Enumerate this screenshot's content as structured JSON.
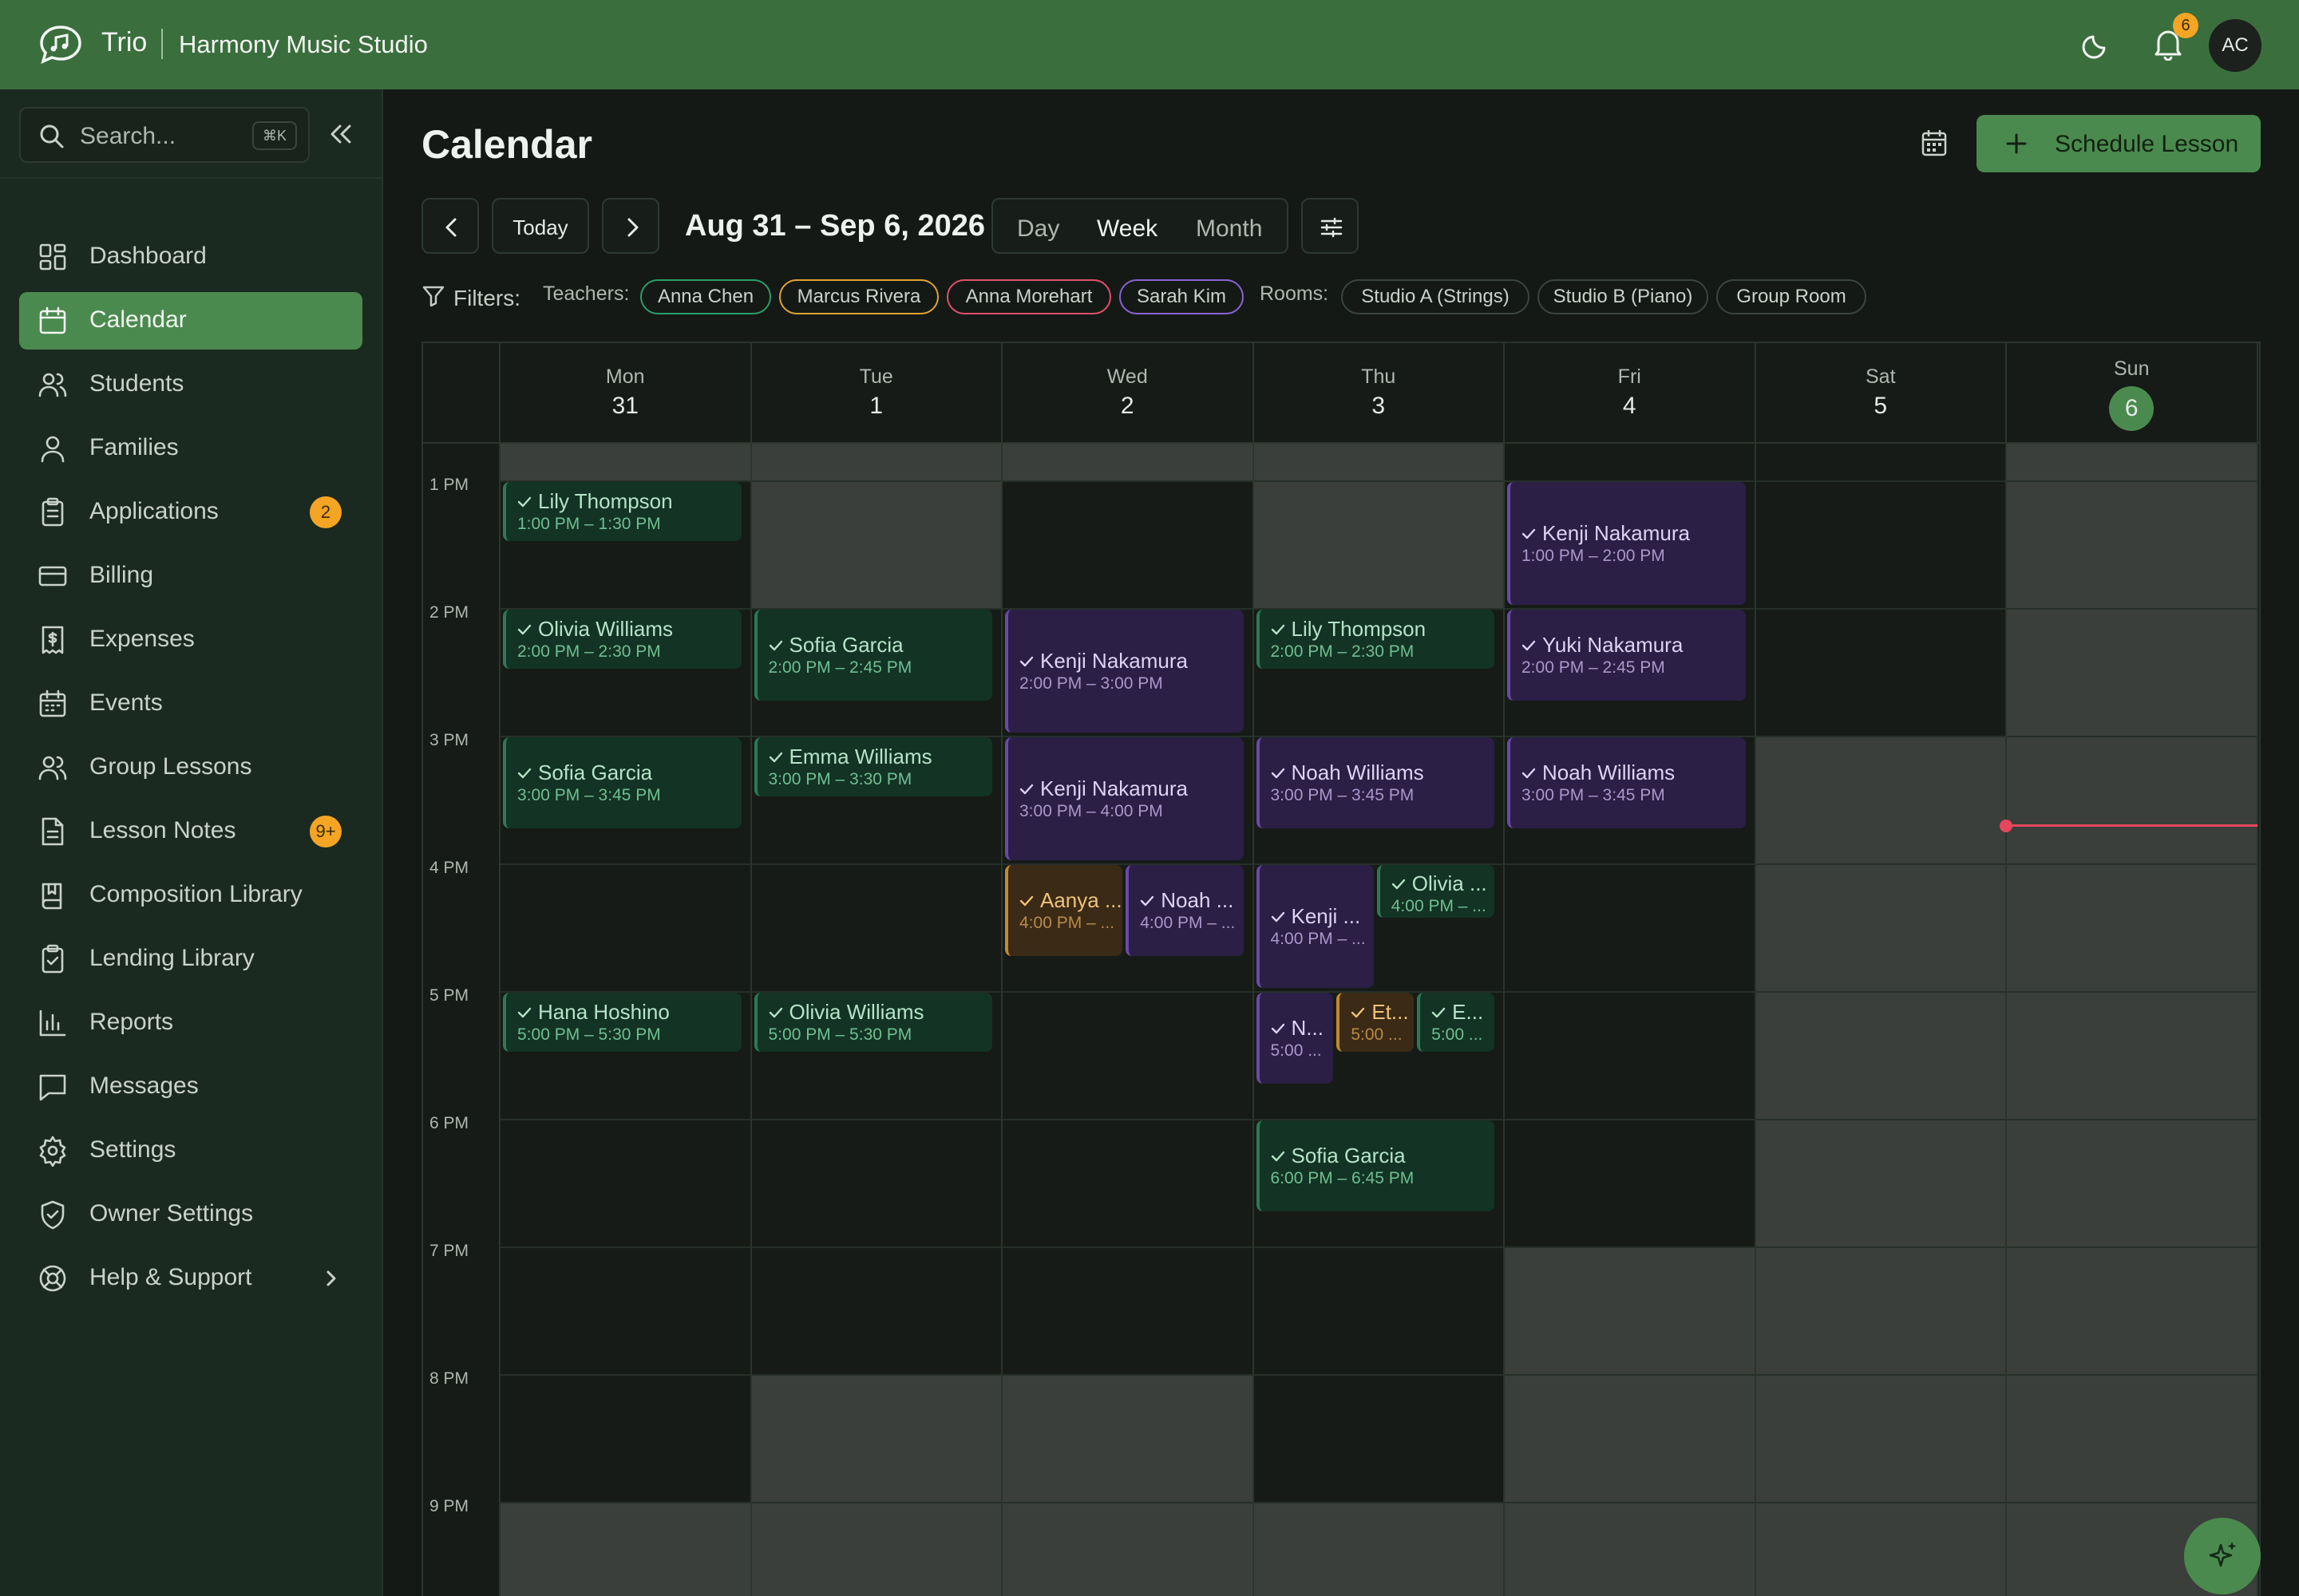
{
  "topbar": {
    "app_name": "Trio",
    "org_name": "Harmony Music Studio",
    "notification_count": "6",
    "avatar_initials": "AC",
    "icons": [
      "logo-chat-music-icon",
      "moon-icon",
      "bell-icon"
    ]
  },
  "sidebar": {
    "search_placeholder": "Search...",
    "search_shortcut": "⌘K",
    "items": [
      {
        "label": "Dashboard",
        "icon": "dashboard-icon"
      },
      {
        "label": "Calendar",
        "icon": "calendar-icon",
        "active": true
      },
      {
        "label": "Students",
        "icon": "users-icon"
      },
      {
        "label": "Families",
        "icon": "user-icon"
      },
      {
        "label": "Applications",
        "icon": "clipboard-icon",
        "badge": "2"
      },
      {
        "label": "Billing",
        "icon": "credit-card-icon"
      },
      {
        "label": "Expenses",
        "icon": "receipt-icon"
      },
      {
        "label": "Events",
        "icon": "calendar-grid-icon"
      },
      {
        "label": "Group Lessons",
        "icon": "group-icon"
      },
      {
        "label": "Lesson Notes",
        "icon": "notes-icon",
        "badge": "9+"
      },
      {
        "label": "Composition Library",
        "icon": "book-icon"
      },
      {
        "label": "Lending Library",
        "icon": "clipboard-check-icon"
      },
      {
        "label": "Reports",
        "icon": "bar-chart-icon"
      },
      {
        "label": "Messages",
        "icon": "message-icon"
      },
      {
        "label": "Settings",
        "icon": "gear-icon"
      },
      {
        "label": "Owner Settings",
        "icon": "shield-icon"
      },
      {
        "label": "Help & Support",
        "icon": "lifebuoy-icon"
      }
    ]
  },
  "main": {
    "title": "Calendar",
    "schedule_button": "Schedule Lesson",
    "today_button": "Today",
    "date_range": "Aug 31 – Sep 6, 2026",
    "views": [
      "Day",
      "Week",
      "Month"
    ],
    "active_view": "Week",
    "filters": {
      "label": "Filters:",
      "teachers_label": "Teachers:",
      "teachers": [
        {
          "name": "Anna Chen",
          "color": "#2b9d6a"
        },
        {
          "name": "Marcus Rivera",
          "color": "#e0a431"
        },
        {
          "name": "Anna Morehart",
          "color": "#e0506b"
        },
        {
          "name": "Sarah Kim",
          "color": "#8a63d2"
        }
      ],
      "rooms_label": "Rooms:",
      "rooms": [
        "Studio A (Strings)",
        "Studio B (Piano)",
        "Group Room"
      ]
    }
  },
  "calendar": {
    "days": [
      {
        "name": "Mon",
        "date": "31"
      },
      {
        "name": "Tue",
        "date": "1"
      },
      {
        "name": "Wed",
        "date": "2"
      },
      {
        "name": "Thu",
        "date": "3"
      },
      {
        "name": "Fri",
        "date": "4"
      },
      {
        "name": "Sat",
        "date": "5"
      },
      {
        "name": "Sun",
        "date": "6",
        "today": true
      }
    ],
    "hours": [
      "1 PM",
      "2 PM",
      "3 PM",
      "4 PM",
      "5 PM",
      "6 PM",
      "7 PM",
      "8 PM",
      "9 PM"
    ],
    "events": [
      {
        "day": 0,
        "start": 13.0,
        "end": 13.5,
        "title": "Lily Thompson",
        "time": "1:00 PM – 1:30 PM",
        "color": "green"
      },
      {
        "day": 0,
        "start": 14.0,
        "end": 14.5,
        "title": "Olivia Williams",
        "time": "2:00 PM – 2:30 PM",
        "color": "green"
      },
      {
        "day": 0,
        "start": 15.0,
        "end": 15.75,
        "title": "Sofia Garcia",
        "time": "3:00 PM – 3:45 PM",
        "color": "green"
      },
      {
        "day": 0,
        "start": 17.0,
        "end": 17.5,
        "title": "Hana Hoshino",
        "time": "5:00 PM – 5:30 PM",
        "color": "green"
      },
      {
        "day": 1,
        "start": 14.0,
        "end": 14.75,
        "title": "Sofia Garcia",
        "time": "2:00 PM – 2:45 PM",
        "color": "green"
      },
      {
        "day": 1,
        "start": 15.0,
        "end": 15.5,
        "title": "Emma Williams",
        "time": "3:00 PM – 3:30 PM",
        "color": "green"
      },
      {
        "day": 1,
        "start": 17.0,
        "end": 17.5,
        "title": "Olivia Williams",
        "time": "5:00 PM – 5:30 PM",
        "color": "green"
      },
      {
        "day": 2,
        "start": 14.0,
        "end": 15.0,
        "title": "Kenji Nakamura",
        "time": "2:00 PM – 3:00 PM",
        "color": "purple"
      },
      {
        "day": 2,
        "start": 15.0,
        "end": 16.0,
        "title": "Kenji Nakamura",
        "time": "3:00 PM – 4:00 PM",
        "color": "purple"
      },
      {
        "day": 2,
        "start": 16.0,
        "end": 16.75,
        "title": "Aanya ...",
        "time": "4:00 PM – ...",
        "color": "amber",
        "col": 0,
        "cols": 2
      },
      {
        "day": 2,
        "start": 16.0,
        "end": 16.75,
        "title": "Noah ...",
        "time": "4:00 PM – ...",
        "color": "purple",
        "col": 1,
        "cols": 2
      },
      {
        "day": 3,
        "start": 14.0,
        "end": 14.5,
        "title": "Lily Thompson",
        "time": "2:00 PM – 2:30 PM",
        "color": "green"
      },
      {
        "day": 3,
        "start": 15.0,
        "end": 15.75,
        "title": "Noah Williams",
        "time": "3:00 PM – 3:45 PM",
        "color": "purple"
      },
      {
        "day": 3,
        "start": 16.0,
        "end": 17.0,
        "title": "Kenji ...",
        "time": "4:00 PM – ...",
        "color": "purple",
        "col": 0,
        "cols": 2
      },
      {
        "day": 3,
        "start": 16.0,
        "end": 16.45,
        "title": "Olivia ...",
        "time": "4:00 PM – ...",
        "color": "green",
        "col": 1,
        "cols": 2
      },
      {
        "day": 3,
        "start": 17.0,
        "end": 17.75,
        "title": "N...",
        "time": "5:00 ...",
        "color": "purple",
        "col": 0,
        "cols": 3
      },
      {
        "day": 3,
        "start": 17.0,
        "end": 17.5,
        "title": "Et...",
        "time": "5:00 ...",
        "color": "amber",
        "col": 1,
        "cols": 3
      },
      {
        "day": 3,
        "start": 17.0,
        "end": 17.5,
        "title": "E...",
        "time": "5:00 ...",
        "color": "green",
        "col": 2,
        "cols": 3
      },
      {
        "day": 3,
        "start": 18.0,
        "end": 18.75,
        "title": "Sofia Garcia",
        "time": "6:00 PM – 6:45 PM",
        "color": "green"
      },
      {
        "day": 4,
        "start": 13.0,
        "end": 14.0,
        "title": "Kenji Nakamura",
        "time": "1:00 PM – 2:00 PM",
        "color": "purple"
      },
      {
        "day": 4,
        "start": 14.0,
        "end": 14.75,
        "title": "Yuki Nakamura",
        "time": "2:00 PM – 2:45 PM",
        "color": "purple"
      },
      {
        "day": 4,
        "start": 15.0,
        "end": 15.75,
        "title": "Noah Williams",
        "time": "3:00 PM – 3:45 PM",
        "color": "purple"
      }
    ],
    "unavailable": [
      {
        "day": 0,
        "start": 12.7,
        "end": 13.0
      },
      {
        "day": 1,
        "start": 12.7,
        "end": 14.0
      },
      {
        "day": 2,
        "start": 12.7,
        "end": 13.0
      },
      {
        "day": 3,
        "start": 12.7,
        "end": 14.0
      },
      {
        "day": 5,
        "start": 15.0,
        "end": 22.0
      },
      {
        "day": 6,
        "start": 12.7,
        "end": 22.0
      },
      {
        "day": 4,
        "start": 19.0,
        "end": 22.0
      },
      {
        "day": 1,
        "start": 20.0,
        "end": 22.0
      },
      {
        "day": 2,
        "start": 20.0,
        "end": 22.0
      },
      {
        "day": 0,
        "start": 21.0,
        "end": 22.0
      },
      {
        "day": 3,
        "start": 21.0,
        "end": 22.0
      }
    ],
    "now_time": 15.7,
    "now_day": 6
  }
}
